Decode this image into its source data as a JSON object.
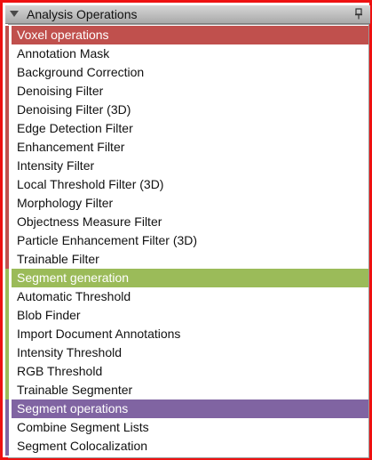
{
  "panel": {
    "title": "Analysis Operations",
    "pin_icon": "pin-icon",
    "collapse_icon": "collapse-triangle-icon"
  },
  "colors": {
    "voxel": "#c0504d",
    "segment_generation": "#9bbb59",
    "segment_operations": "#8064a2",
    "border": "#ee1111"
  },
  "groups": [
    {
      "label": "Voxel operations",
      "items": [
        "Annotation Mask",
        "Background Correction",
        "Denoising Filter",
        "Denoising Filter (3D)",
        "Edge Detection Filter",
        "Enhancement Filter",
        "Intensity Filter",
        "Local Threshold Filter (3D)",
        "Morphology Filter",
        "Objectness Measure Filter",
        "Particle Enhancement Filter (3D)",
        "Trainable Filter"
      ]
    },
    {
      "label": "Segment generation",
      "items": [
        "Automatic Threshold",
        "Blob Finder",
        "Import Document Annotations",
        "Intensity Threshold",
        "RGB Threshold",
        "Trainable Segmenter"
      ]
    },
    {
      "label": "Segment operations",
      "items": [
        "Combine Segment Lists",
        "Segment Colocalization"
      ]
    }
  ]
}
